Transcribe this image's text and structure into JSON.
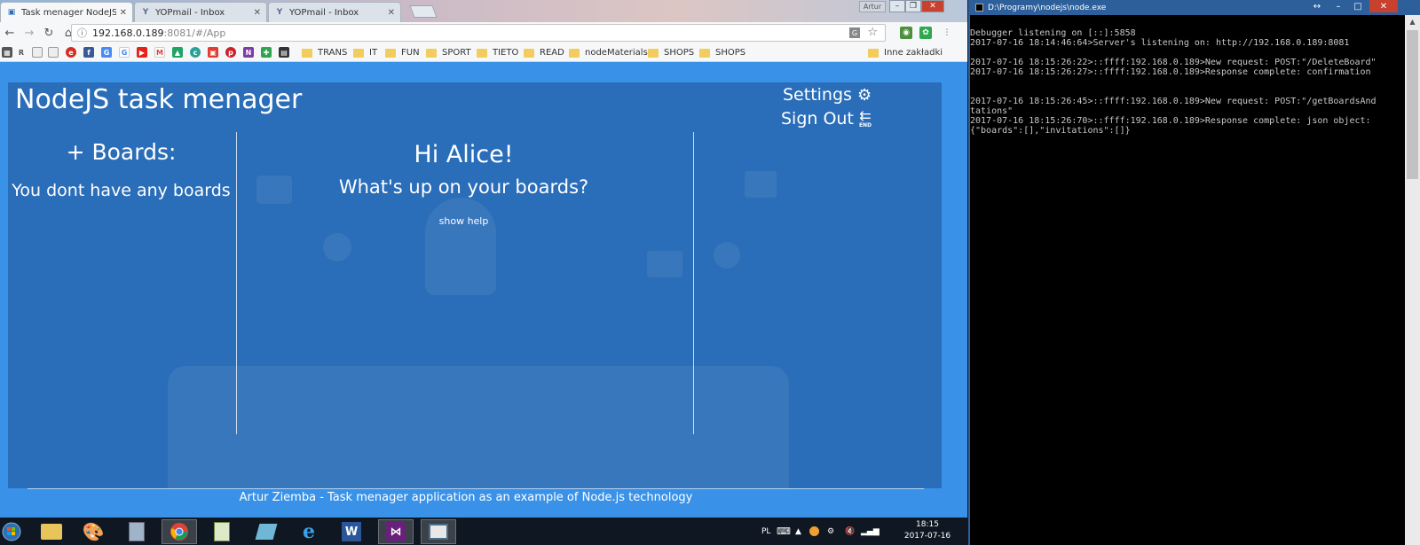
{
  "browser": {
    "tabs": [
      {
        "title": "Task menager NodeJS",
        "favicon": "tab-blank-icon"
      },
      {
        "title": "YOPmail - Inbox",
        "favicon": "yopmail-icon"
      },
      {
        "title": "YOPmail - Inbox",
        "favicon": "yopmail-icon"
      }
    ],
    "profile_label": "Artur",
    "url_host": "192.168.0.189",
    "url_rest": ":8081/#/App",
    "bookmarks": {
      "letter": "R",
      "folders": [
        "TRANS",
        "IT",
        "FUN",
        "SPORT",
        "TIETO",
        "READ",
        "nodeMaterials",
        "SHOPS",
        "SHOPS"
      ],
      "other": "Inne zakładki"
    }
  },
  "app": {
    "title": "NodeJS task menager",
    "settings_label": "Settings",
    "signout_label": "Sign Out",
    "signout_icon_text": "END",
    "boards_heading": "+ Boards:",
    "boards_empty": "You dont have any boards",
    "greeting": "Hi Alice!",
    "subtitle": "What's up on your boards?",
    "show_help": "show help",
    "footer": "Artur Ziemba - Task menager application as an example of Node.js technology",
    "colors": {
      "page_bg": "#3a92e8",
      "panel_bg": "#2a6db8",
      "text": "#ffffff"
    }
  },
  "console": {
    "title": "D:\\Programy\\nodejs\\node.exe",
    "lines": [
      "Debugger listening on [::]:5858",
      "2017-07-16 18:14:46:64>Server's listening on: http://192.168.0.189:8081",
      "",
      "2017-07-16 18:15:26:22>::ffff:192.168.0.189>New request: POST:\"/DeleteBoard\"",
      "2017-07-16 18:15:26:27>::ffff:192.168.0.189>Response complete: confirmation",
      "",
      "",
      "2017-07-16 18:15:26:45>::ffff:192.168.0.189>New request: POST:\"/getBoardsAnd",
      "tations\"",
      "2017-07-16 18:15:26:70>::ffff:192.168.0.189>Response complete: json object:",
      "{\"boards\":[],\"invitations\":[]}"
    ]
  },
  "taskbar": {
    "language": "PL",
    "time": "18:15",
    "date": "2017-07-16"
  }
}
